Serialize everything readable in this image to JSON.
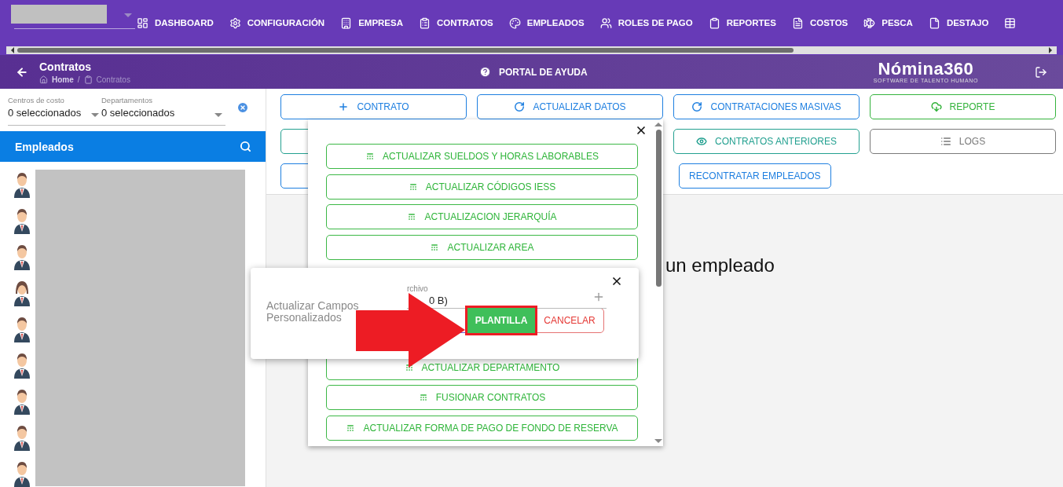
{
  "nav": {
    "items": [
      {
        "label": "DASHBOARD"
      },
      {
        "label": "CONFIGURACIÓN"
      },
      {
        "label": "EMPRESA"
      },
      {
        "label": "CONTRATOS"
      },
      {
        "label": "EMPLEADOS"
      },
      {
        "label": "ROLES DE PAGO"
      },
      {
        "label": "REPORTES"
      },
      {
        "label": "COSTOS"
      },
      {
        "label": "PESCA"
      },
      {
        "label": "DESTAJO"
      },
      {
        "kind": "icon_only"
      }
    ]
  },
  "header": {
    "title": "Contratos",
    "breadcrumb": [
      {
        "label": "Home",
        "current": false
      },
      {
        "label": "Contratos",
        "current": true
      }
    ],
    "separator": "/",
    "help": "PORTAL DE AYUDA",
    "brand": "Nómina360",
    "tagline": "SOFTWARE DE TALENTO HUMANO"
  },
  "filters": [
    {
      "label": "Centros de costo",
      "value": "0 seleccionados"
    },
    {
      "label": "Departamentos",
      "value": "0 seleccionados"
    }
  ],
  "employees": {
    "title": "Empleados",
    "items": [
      {
        "kind": "male"
      },
      {
        "kind": "male"
      },
      {
        "kind": "male"
      },
      {
        "kind": "female"
      },
      {
        "kind": "male"
      },
      {
        "kind": "male"
      },
      {
        "kind": "male"
      },
      {
        "kind": "male"
      },
      {
        "kind": "male"
      }
    ]
  },
  "actions": [
    [
      {
        "label": "CONTRATO",
        "kind": "blue"
      },
      {
        "label": "ACTUALIZAR DATOS",
        "kind": "blue"
      },
      {
        "label": "CONTRATACIONES MASIVAS",
        "kind": "blue"
      },
      {
        "label": "REPORTE",
        "kind": "green"
      }
    ],
    [
      {
        "kind": "teal"
      },
      {
        "kind": "covered"
      },
      {
        "label": "CONTRATOS ANTERIORES",
        "kind": "teal"
      },
      {
        "label": "LOGS",
        "kind": "gray"
      }
    ],
    [
      {
        "kind": "blue"
      },
      {
        "kind": "covered"
      },
      {
        "label": "RECONTRATAR EMPLEADOS",
        "kind": "blue"
      }
    ]
  ],
  "empty_message": "un empleado",
  "menu": {
    "items_above": [
      {
        "label": "ACTUALIZAR SUELDOS Y HORAS LABORABLES"
      },
      {
        "label": "ACTUALIZAR CÓDIGOS IESS"
      },
      {
        "label": "ACTUALIZACION JERARQUÍA"
      },
      {
        "label": "ACTUALIZAR AREA"
      }
    ],
    "items_below": [
      {
        "label": "ACTUALIZAR DEPARTAMENTO"
      },
      {
        "label": "FUSIONAR CONTRATOS"
      },
      {
        "label": "ACTUALIZAR FORMA DE PAGO DE FONDO DE RESERVA"
      }
    ]
  },
  "dialog": {
    "title": "Actualizar Campos Personalizados",
    "field_label": "rchivo",
    "field_value": "0 B)",
    "buttons": [
      {
        "kind": "outline"
      },
      {
        "label": "PLANTILLA",
        "kind": "primary",
        "highlighted": true
      },
      {
        "label": "CANCELAR",
        "kind": "danger",
        "highlighted": false
      }
    ]
  }
}
